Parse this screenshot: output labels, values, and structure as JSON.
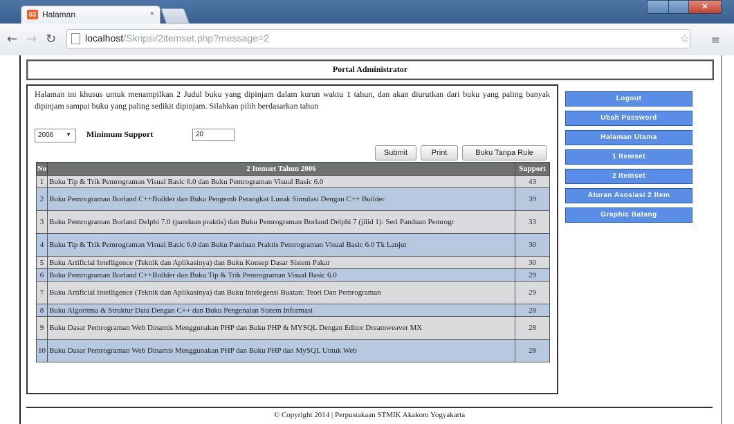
{
  "browser": {
    "tab_title": "Halaman",
    "tab_close": "×",
    "favicon": "03",
    "url_host": "localhost",
    "url_path": "/Skripsi/2itemset.php?message=2"
  },
  "page": {
    "header_title": "Portal Administrator",
    "intro": "Halaman ini khusus untuk menampilkan 2 Judul buku yang dipinjam dalam kurun waktu 1 tahun, dan akan diurutkan dari buku yang paling banyak dipinjam sampai buku yang paling sedikit dipinjam. Silahkan pilih berdasarkan tahun",
    "year_value": "2006",
    "min_support_label": "Minimum Support",
    "min_support_value": "20",
    "buttons": {
      "submit": "Submit",
      "print": "Print",
      "norule": "Buku Tanpa Rule"
    },
    "table": {
      "headers": [
        "No",
        "2 Itemset Tahun 2006",
        "Support"
      ],
      "rows": [
        {
          "no": "1",
          "item": "Buku Tip & Trik Pemrograman Visual Basic 6.0 dan Buku Pemrograman Visual Basic 6.0",
          "support": "43"
        },
        {
          "no": "2",
          "item": "Buku Pemrograman Borland C++Builder dan Buku Pengemb Perangkat Lunak Simulasi Dengan C++ Builder",
          "support": "39"
        },
        {
          "no": "3",
          "item": "Buku Pemrograman Borland Delphi 7.0 (panduan praktis) dan Buku Pemrograman Borland Delphi 7 (jilid 1): Seri Panduan Pemrogr",
          "support": "33"
        },
        {
          "no": "4",
          "item": "Buku Tip & Trik Pemrograman Visual Basic 6.0 dan Buku Panduan Praktis Pemrograman Visual Basic 6.0 Tk Lanjut",
          "support": "30"
        },
        {
          "no": "5",
          "item": "Buku Artificial Intelligence (Teknik dan Aplikasinya) dan Buku Konsep Dasar Sistem Pakar",
          "support": "30"
        },
        {
          "no": "6",
          "item": "Buku Pemrograman Borland C++Builder dan Buku Tip & Trik Pemrograman Visual Basic 6.0",
          "support": "29"
        },
        {
          "no": "7",
          "item": "Buku Artificial Intelligence (Teknik dan Aplikasinya) dan Buku Intelegensi Buatan: Teori Dan Pemrograman",
          "support": "29"
        },
        {
          "no": "8",
          "item": "Buku Algoritma & Struktur Data Dengan C++ dan Buku Pengenalan Sistem Informasi",
          "support": "28"
        },
        {
          "no": "9",
          "item": "Buku Dasar Pemrograman Web Dinamis Menggunakan PHP dan Buku PHP & MYSQL Dengan Editor Dreamweaver MX",
          "support": "28"
        },
        {
          "no": "10",
          "item": "Buku Dasar Pemrograman Web Dinamis Menggunakan PHP dan Buku PHP dan MySQL Untuk Web",
          "support": "28"
        }
      ]
    },
    "sidebar": [
      "Logout",
      "Ubah Password",
      "Halaman Utama",
      "1 Itemset",
      "2 Itemset",
      "Aturan Asosiasi 2 Item",
      "Graphic Batang"
    ],
    "footer": "© Copyright 2014 | Perpustakaan STMIK Akakom Yogyakarta"
  }
}
